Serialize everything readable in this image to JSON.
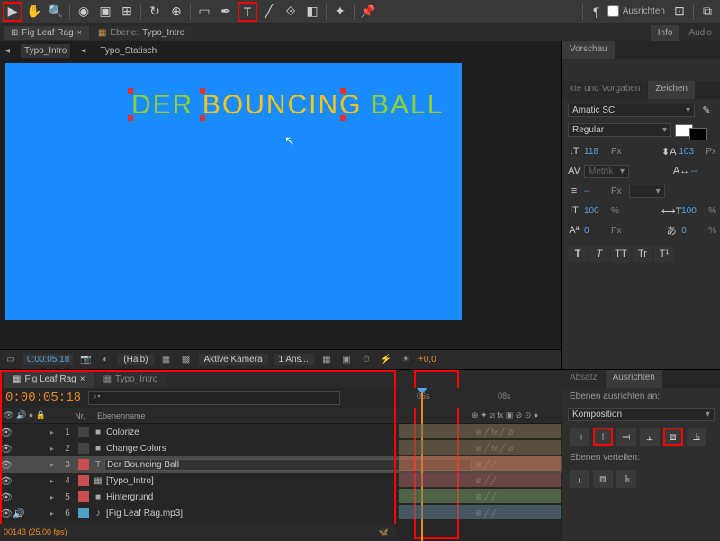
{
  "toolbar": {
    "ausrichten": "Ausrichten"
  },
  "comp_tabs": {
    "tab1": "Fig Leaf Rag",
    "tab2_prefix": "Ebene:",
    "tab2": "Typo_Intro"
  },
  "info_tabs": {
    "info": "Info",
    "audio": "Audio"
  },
  "view_tabs": {
    "t1": "Typo_Intro",
    "t2": "Typo_Statisch"
  },
  "canvas_text": {
    "word1": "DER",
    "word2": "BOUNCING",
    "word3": "BALL"
  },
  "viewer_footer": {
    "tc": "0:00:05:18",
    "res": "(Halb)",
    "camera": "Aktive Kamera",
    "views": "1 Ans...",
    "exposure": "+0,0"
  },
  "vorschau": "Vorschau",
  "effects": {
    "effects": "kte und Vorgaben",
    "zeichen": "Zeichen"
  },
  "font": {
    "family": "Amatic SC",
    "style": "Regular"
  },
  "char": {
    "size": "118",
    "leading": "103",
    "kerning": "Metrik",
    "tracking": "--",
    "stroke_dash": "--",
    "vscale": "100",
    "hscale": "100",
    "baseline": "0",
    "tsume": "0",
    "px": "Px",
    "pct": "%"
  },
  "style": {
    "t": "T",
    "tt": "TT",
    "tr": "Tr",
    "t1": "T¹"
  },
  "timeline": {
    "tab1": "Fig Leaf Rag",
    "tab2": "Typo_Intro",
    "tc": "0:00:05:18",
    "fps": "00143 (25.00 fps)",
    "search_icon": "⌕▾",
    "cols": {
      "nr": "Nr.",
      "name": "Ebenenname"
    },
    "ruler": {
      "t6": "06s",
      "t8": "08s"
    },
    "layers": [
      {
        "nr": "1",
        "name": "Colorize",
        "color": "#444",
        "icon": "■"
      },
      {
        "nr": "2",
        "name": "Change Colors",
        "color": "#444",
        "icon": "■"
      },
      {
        "nr": "3",
        "name": "Der Bouncing Ball",
        "color": "#c94f4f",
        "icon": "T"
      },
      {
        "nr": "4",
        "name": "[Typo_Intro]",
        "color": "#c94f4f",
        "icon": "▦"
      },
      {
        "nr": "5",
        "name": "Hintergrund",
        "color": "#c94f4f",
        "icon": "■"
      },
      {
        "nr": "6",
        "name": "[Fig Leaf Rag.mp3]",
        "color": "#4fa0c9",
        "icon": "♪"
      }
    ]
  },
  "align": {
    "tab1": "Absatz",
    "tab2": "Ausrichten",
    "label1": "Ebenen ausrichten an:",
    "target": "Komposition",
    "label2": "Ebenen verteilen:"
  }
}
